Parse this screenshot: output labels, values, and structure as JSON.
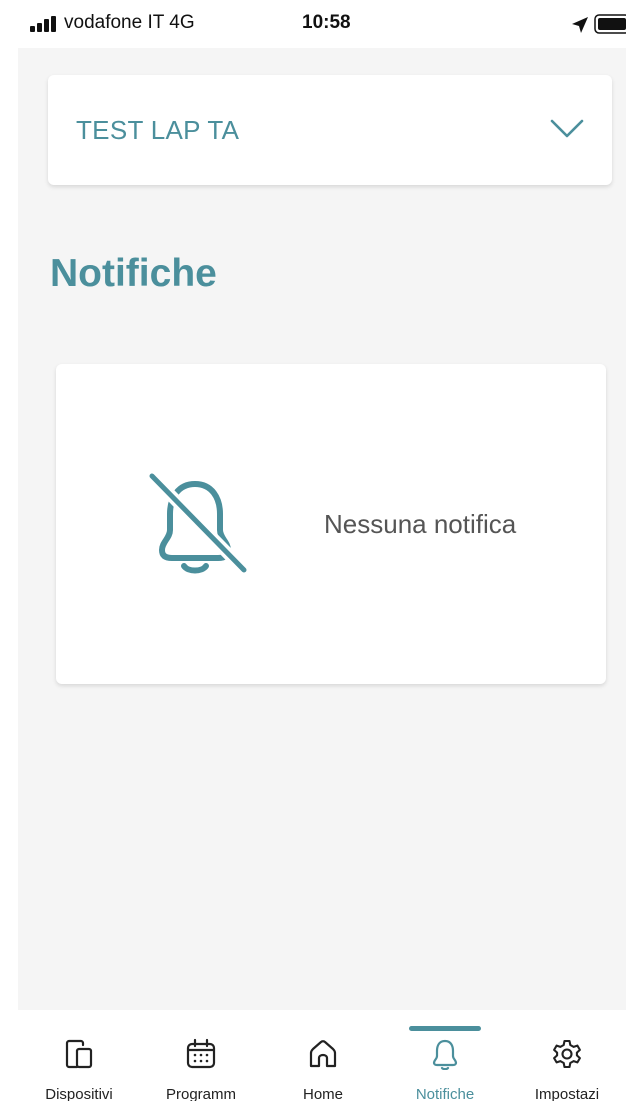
{
  "status_bar": {
    "carrier": "vodafone IT  4G",
    "time": "10:58"
  },
  "device_selector": {
    "name": "TEST LAP TA"
  },
  "page": {
    "title": "Notifiche"
  },
  "empty_state": {
    "message": "Nessuna notifica",
    "icon": "bell-off-icon"
  },
  "tab_bar": {
    "active_tab": "Notifiche",
    "tabs": [
      {
        "label": "Dispositivi",
        "icon": "devices-icon"
      },
      {
        "label": "Programm",
        "icon": "calendar-icon"
      },
      {
        "label": "Home",
        "icon": "home-icon"
      },
      {
        "label": "Notifiche",
        "icon": "bell-icon"
      },
      {
        "label": "Impostazi",
        "icon": "gear-icon"
      }
    ]
  },
  "colors": {
    "accent": "#4b8f9c",
    "background": "#f5f5f5",
    "card": "#ffffff",
    "muted_text": "#555555"
  }
}
